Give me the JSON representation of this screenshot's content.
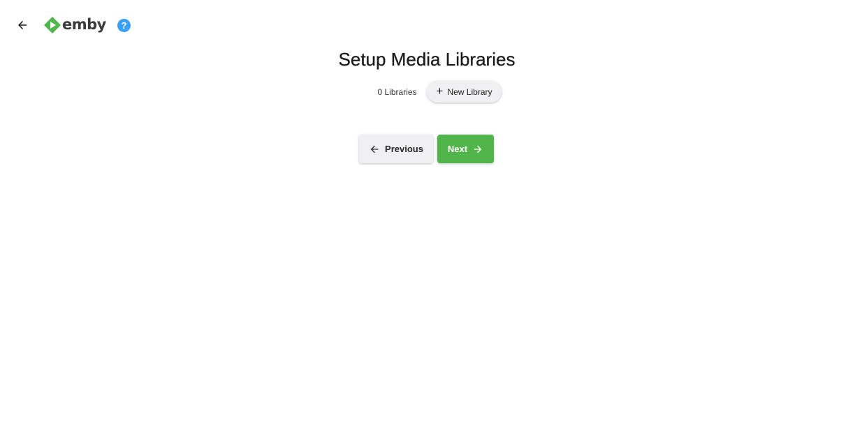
{
  "header": {
    "back_icon": "arrow-left-icon",
    "logo_text": "emby",
    "logo_color": "#52b54b",
    "help_label": "?",
    "help_color": "#3aa0f3"
  },
  "main": {
    "title": "Setup Media Libraries",
    "library_count": "0 Libraries",
    "new_library_label": "New Library",
    "new_library_icon": "plus-icon"
  },
  "nav": {
    "previous_label": "Previous",
    "next_label": "Next",
    "next_color": "#52b54b"
  }
}
